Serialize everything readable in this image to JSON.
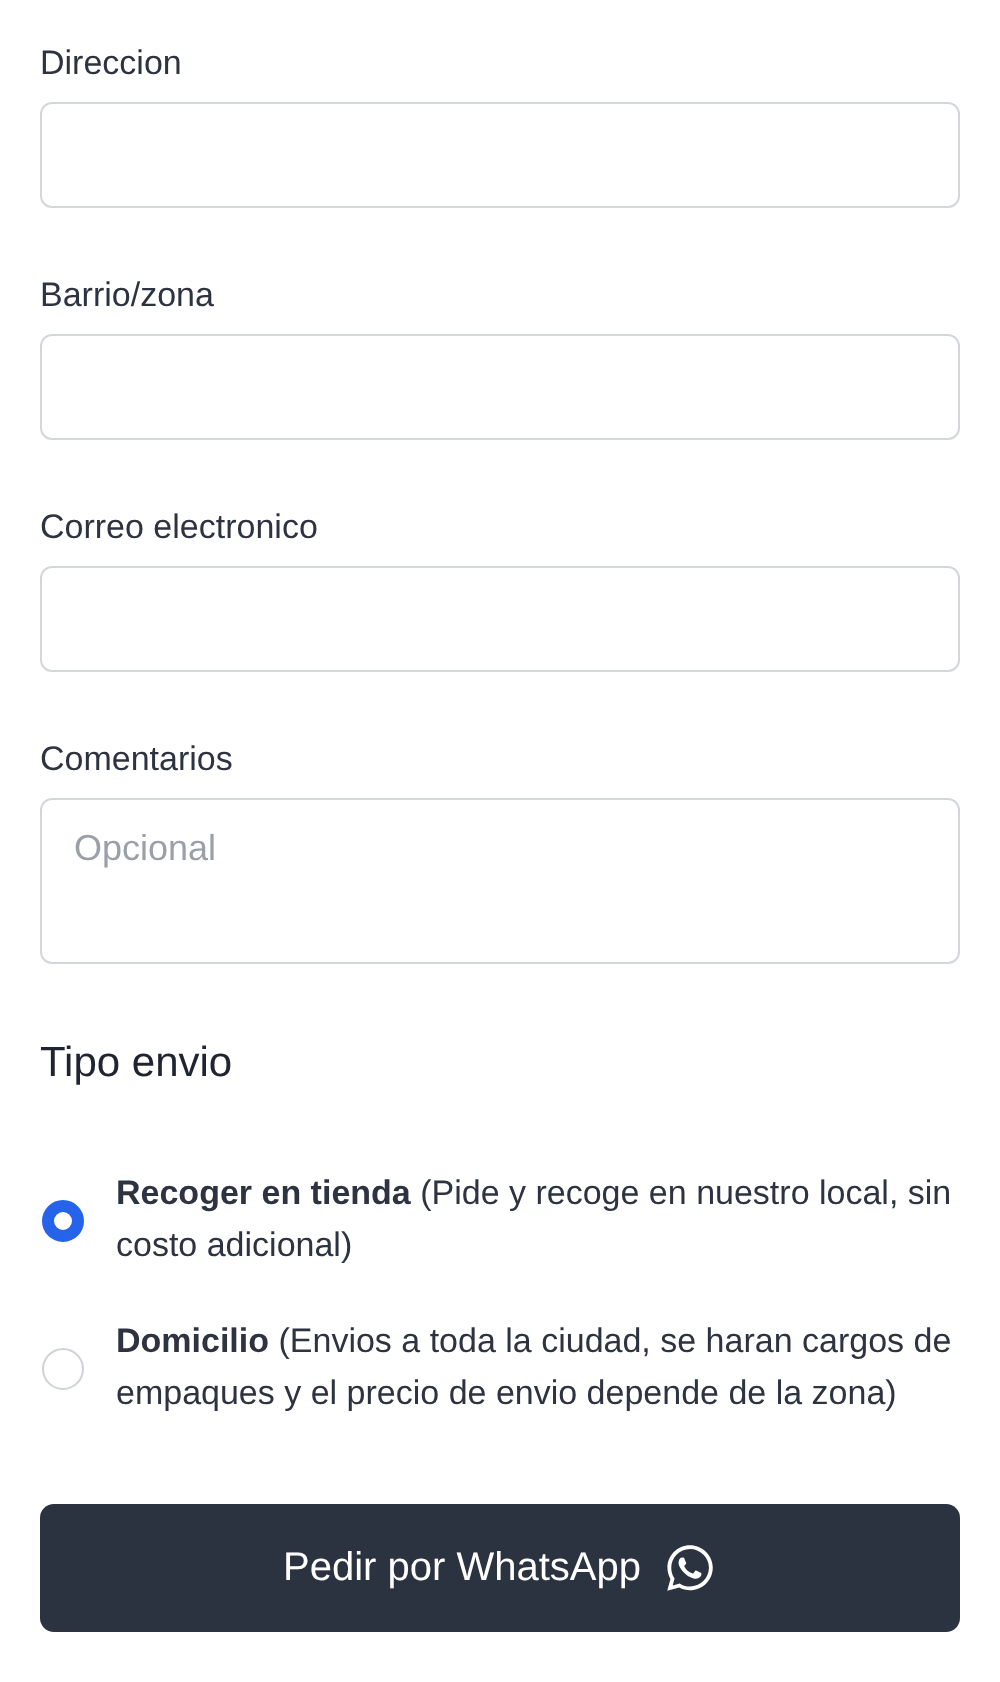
{
  "fields": [
    {
      "label": "Direccion",
      "kind": "input"
    },
    {
      "label": "Barrio/zona",
      "kind": "input"
    },
    {
      "label": "Correo electronico",
      "kind": "input"
    },
    {
      "label": "Comentarios",
      "kind": "textarea",
      "placeholder": "Opcional"
    }
  ],
  "shipping": {
    "title": "Tipo envio",
    "options": [
      {
        "text": "**Recoger en tienda** (Pide y recoge en nuestro local, sin costo adicional)",
        "selected": true
      },
      {
        "text": "**Domicilio** (Envios a toda la ciudad, se haran cargos de empaques y el precio de envio depende de la zona)",
        "selected": false
      }
    ]
  },
  "submit": {
    "label": "Pedir por WhatsApp"
  }
}
